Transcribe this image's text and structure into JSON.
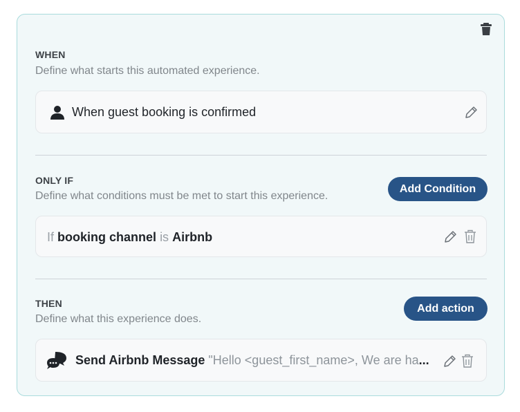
{
  "when": {
    "title": "WHEN",
    "description": "Define what starts this automated experience.",
    "trigger_label": "When guest booking is confirmed",
    "trigger_icon": "person-icon"
  },
  "only_if": {
    "title": "ONLY IF",
    "description": "Define what conditions must be met to start this experience.",
    "add_button": "Add Condition",
    "condition": {
      "prefix": "If",
      "field": "booking channel",
      "operator": "is",
      "value": "Airbnb"
    }
  },
  "then": {
    "title": "THEN",
    "description": "Define what this experience does.",
    "add_button": "Add action",
    "action": {
      "label": "Send Airbnb Message",
      "preview": "\"Hello <guest_first_name>, We are ha",
      "ellipsis": "...",
      "icon": "chat-bubbles-icon"
    }
  },
  "colors": {
    "card_bg": "#f1f8f9",
    "card_border": "#a9dbdc",
    "button_bg": "#285487"
  }
}
